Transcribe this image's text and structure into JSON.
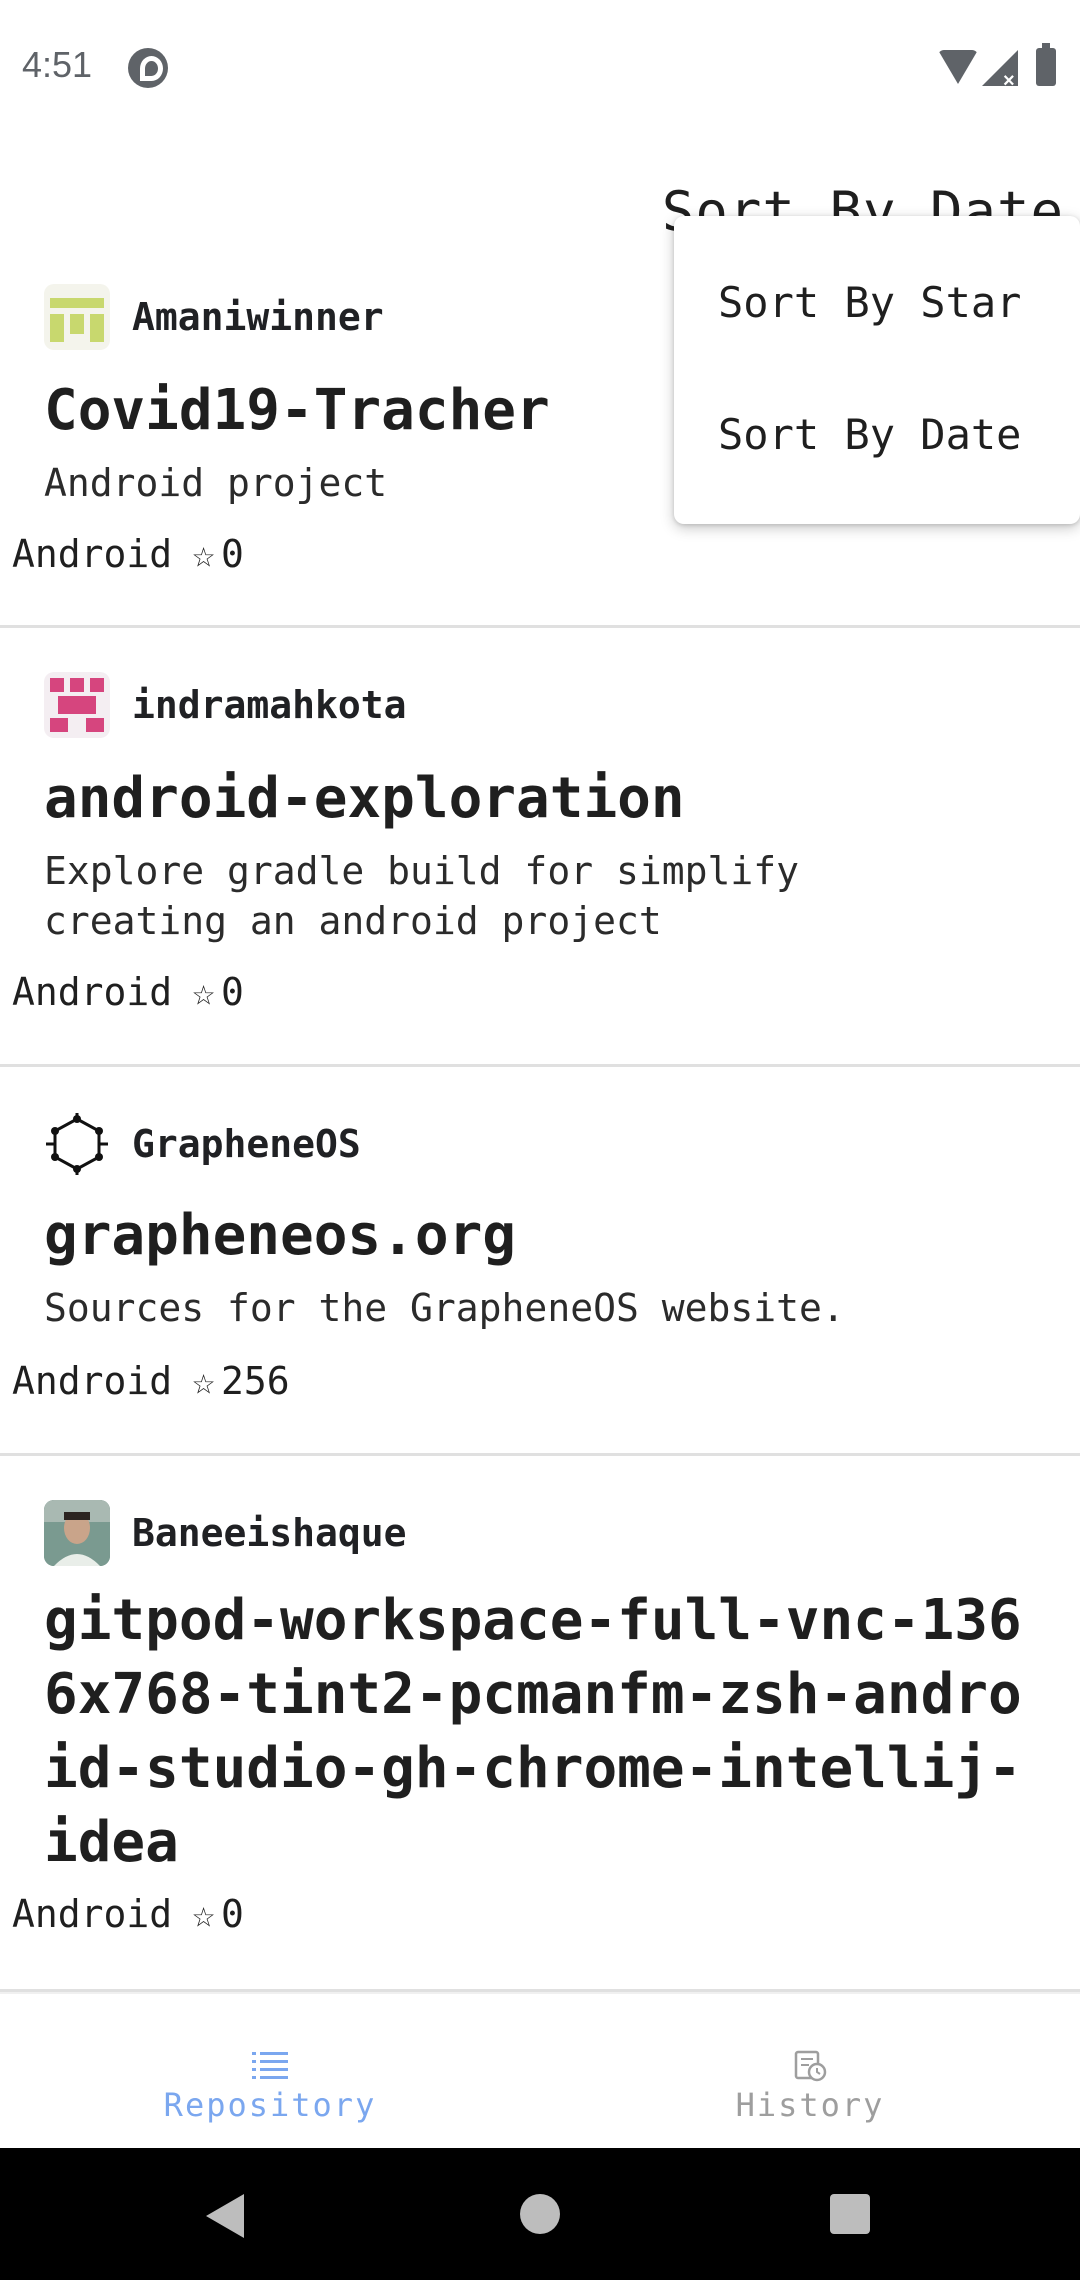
{
  "status_bar": {
    "time": "4:51"
  },
  "toolbar": {
    "sort_title": "Sort By Date"
  },
  "sort_menu": {
    "items": [
      "Sort By Star",
      "Sort By Date"
    ]
  },
  "repos": [
    {
      "owner": "Amaniwinner",
      "name": "Covid19-Tracher",
      "description": "Android project",
      "language": "Android",
      "stars": "0"
    },
    {
      "owner": "indramahkota",
      "name": "android-exploration",
      "description": "Explore gradle build for simplify creating an android project",
      "language": "Android",
      "stars": "0"
    },
    {
      "owner": "GrapheneOS",
      "name": "grapheneos.org",
      "description": "Sources for the GrapheneOS website.",
      "language": "Android",
      "stars": "256"
    },
    {
      "owner": "Baneeishaque",
      "name": "gitpod-workspace-full-vnc-1366x768-tint2-pcmanfm-zsh-android-studio-gh-chrome-intellij-idea",
      "description": "",
      "language": "Android",
      "stars": "0"
    }
  ],
  "bottom_nav": {
    "items": [
      {
        "label": "Repository",
        "icon": "list-icon",
        "active": true
      },
      {
        "label": "History",
        "icon": "history-icon",
        "active": false
      }
    ]
  },
  "colors": {
    "active": "#7ba7ef",
    "inactive": "#9e9e9e"
  }
}
